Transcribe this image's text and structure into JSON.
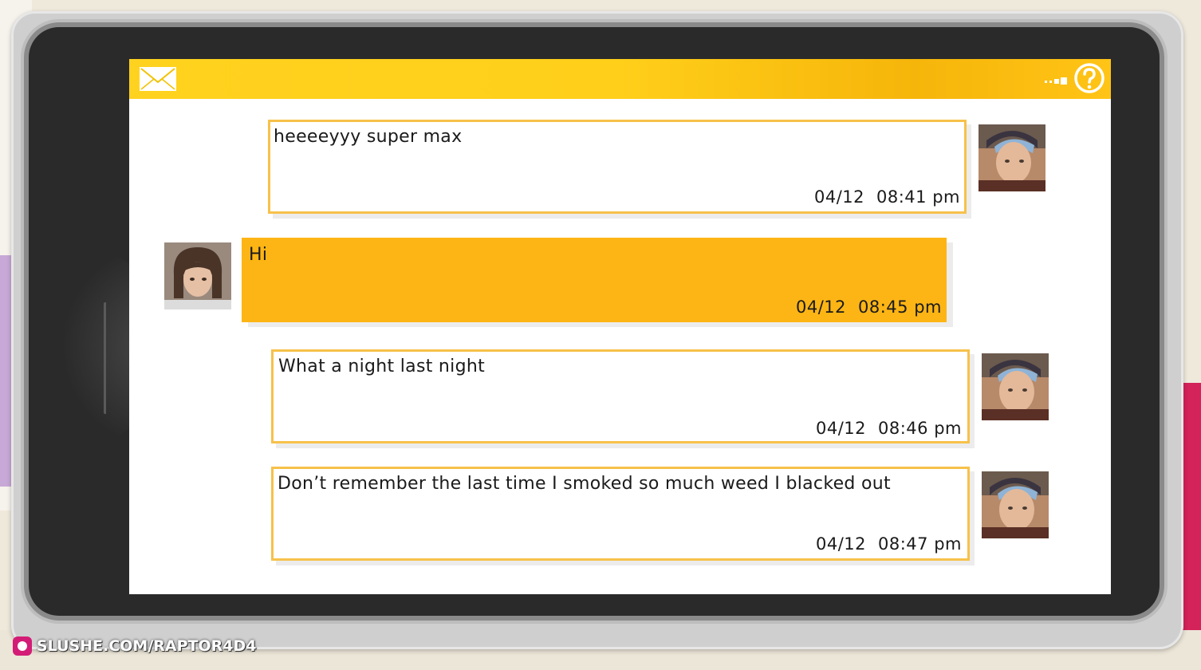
{
  "header": {
    "mail_icon": "envelope-icon",
    "signal_icon": "signal-dots-icon",
    "help_icon": "question-circle-icon",
    "accent_color": "#ffc916"
  },
  "messages": [
    {
      "sender": "contact",
      "text": "heeeeyyy super max",
      "date": "04/12",
      "time": "08:41 pm"
    },
    {
      "sender": "self",
      "text": "Hi",
      "date": "04/12",
      "time": "08:45 pm"
    },
    {
      "sender": "contact",
      "text": "What a night last night",
      "date": "04/12",
      "time": "08:46 pm"
    },
    {
      "sender": "contact",
      "text": "Don’t remember the last time I smoked so much weed I blacked out",
      "date": "04/12",
      "time": "08:47 pm"
    }
  ],
  "colors": {
    "sent_bubble": "#fdb515",
    "received_border": "#f7c14a",
    "bezel": "#2a2a2a"
  },
  "watermark": {
    "text": "SLUSHE.COM/RAPTOR4D4"
  }
}
